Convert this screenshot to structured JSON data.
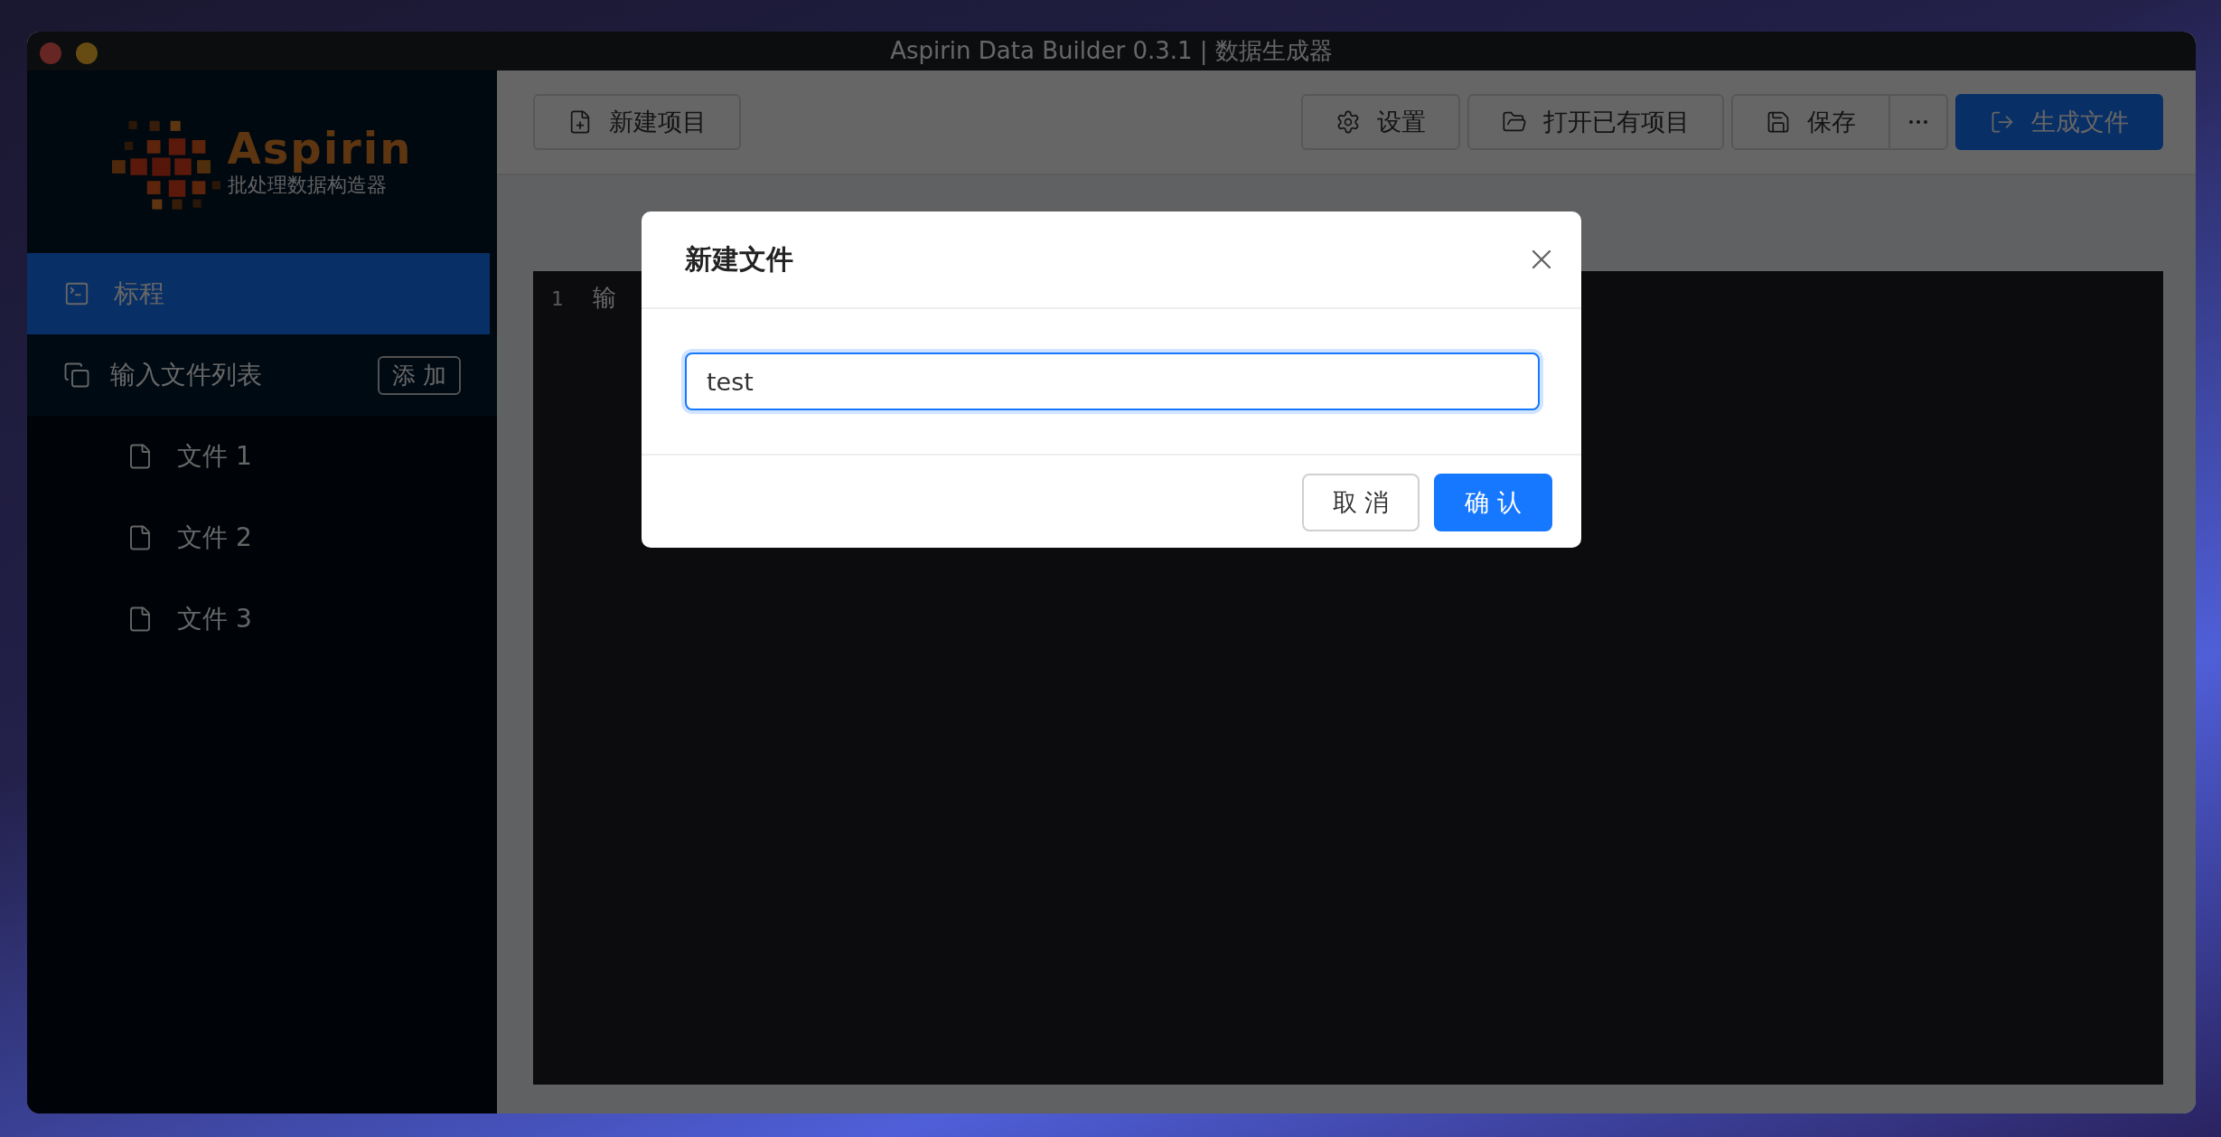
{
  "window": {
    "title": "Aspirin Data Builder 0.3.1 | 数据生成器"
  },
  "sidebar": {
    "logo": {
      "name": "Aspirin",
      "subtitle": "批处理数据构造器"
    },
    "items": [
      {
        "kind": "entry",
        "label": "标程",
        "selected": true
      },
      {
        "kind": "group",
        "label": "输入文件列表",
        "selected": false,
        "button": "添 加",
        "children": [
          {
            "label": "文件 1",
            "selected": false
          },
          {
            "label": "文件 2",
            "selected": false
          },
          {
            "label": "文件 3",
            "selected": false
          }
        ]
      }
    ]
  },
  "toolbar": {
    "left": [
      {
        "kind": "default",
        "label": "新建项目"
      }
    ],
    "right": [
      {
        "kind": "default",
        "label": "设置"
      },
      {
        "kind": "default",
        "label": "打开已有项目"
      },
      {
        "kind": "split",
        "label": "保存"
      },
      {
        "kind": "primary",
        "label": "生成文件"
      }
    ]
  },
  "editor": {
    "lines": [
      {
        "number": "1",
        "text": "输"
      }
    ]
  },
  "dialog": {
    "title": "新建文件",
    "input": {
      "value": "test"
    },
    "buttons": [
      {
        "kind": "default",
        "label": "取 消"
      },
      {
        "kind": "primary",
        "label": "确 认"
      }
    ]
  }
}
